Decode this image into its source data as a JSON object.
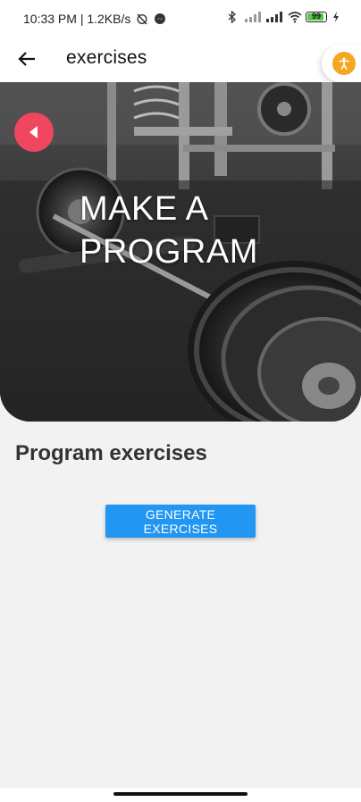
{
  "status_bar": {
    "time_speed": "10:33 PM | 1.2KB/s",
    "battery_level": "99"
  },
  "app_bar": {
    "title": "exercises",
    "back_icon": "arrow-left-icon",
    "accessibility_icon": "accessibility-icon",
    "accessibility_color": "#f5a623"
  },
  "hero": {
    "heading": "MAKE A PROGRAM",
    "back_icon": "play-back-icon",
    "back_button_color": "#f0465e"
  },
  "main": {
    "section_title": "Program exercises",
    "generate_button_label": "GENERATE EXERCISES",
    "button_color": "#2196f3"
  }
}
